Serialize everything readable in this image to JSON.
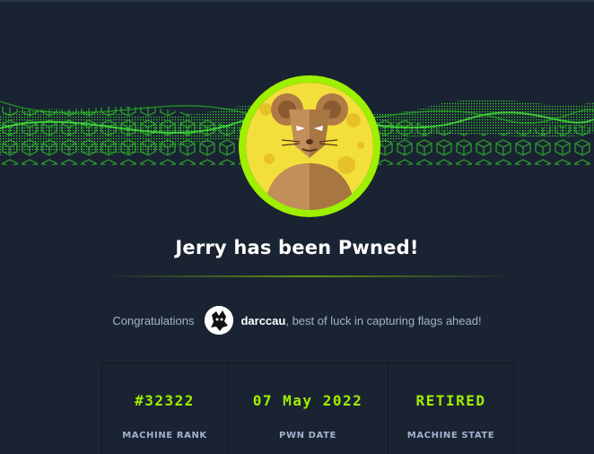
{
  "title": "Jerry has been Pwned!",
  "congrats": {
    "prefix": "Congratulations",
    "username": "darccau",
    "suffix": ", best of luck in capturing flags ahead!"
  },
  "stats": [
    {
      "value": "#32322",
      "label": "MACHINE RANK"
    },
    {
      "value": "07 May 2022",
      "label": "PWN DATE"
    },
    {
      "value": "RETIRED",
      "label": "MACHINE STATE"
    }
  ],
  "colors": {
    "accent": "#9fef00",
    "background": "#1a2332",
    "muted_text": "#a4b1cd"
  },
  "icons": {
    "machine_avatar": "jerry-mouse-avatar-icon",
    "user_avatar": "user-avatar-icon",
    "banner": "green-cube-wave-banner"
  }
}
